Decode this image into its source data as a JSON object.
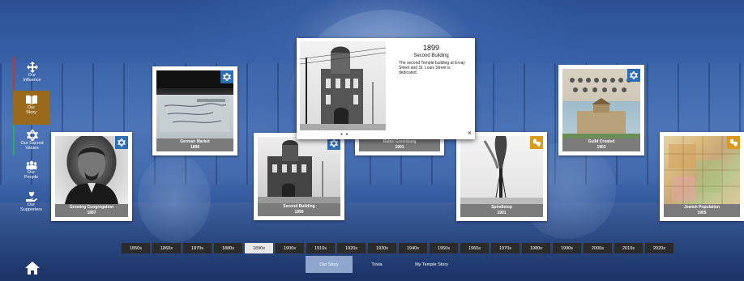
{
  "sidebar": {
    "items": [
      {
        "label1": "Our",
        "label2": "Influence",
        "icon": "arrows-move-icon"
      },
      {
        "label1": "Our",
        "label2": "Story",
        "icon": "open-book-icon"
      },
      {
        "label1": "Our Sacred",
        "label2": "Values",
        "icon": "star-of-david-icon"
      },
      {
        "label1": "Our",
        "label2": "People",
        "icon": "people-group-icon"
      },
      {
        "label1": "Our",
        "label2": "Supporters",
        "icon": "heart-hand-icon"
      }
    ],
    "active_index": 1
  },
  "cards": [
    {
      "title": "Growing Congregation",
      "year": "1897",
      "badge": "blue"
    },
    {
      "title": "German Market",
      "year": "1898",
      "badge": "blue"
    },
    {
      "title": "Second Building",
      "year": "1899",
      "badge": "blue"
    },
    {
      "title": "Rabbi Greenburg",
      "year": "1901",
      "badge": "blue"
    },
    {
      "title": "Spindletop",
      "year": "1901",
      "badge": "gold"
    },
    {
      "title": "Guild Created",
      "year": "1903",
      "badge": "blue"
    },
    {
      "title": "Jewish Population",
      "year": "1905",
      "badge": "gold"
    }
  ],
  "popup": {
    "year": "1899",
    "title": "Second Building",
    "description": "The second Temple building at Ervay Street and St. Louis Street is dedicated.",
    "close": "×",
    "dots": "● ●"
  },
  "decades": [
    "1850s",
    "1860s",
    "1870s",
    "1880s",
    "1890s",
    "1900s",
    "1910s",
    "1920s",
    "1930s",
    "1940s",
    "1950s",
    "1960s",
    "1970s",
    "1980s",
    "1990s",
    "2000s",
    "2010s",
    "2020s"
  ],
  "active_decade": "1890s",
  "tabs": [
    "Our Story",
    "Trivia",
    "My Temple Story"
  ],
  "active_tab": "Our Story",
  "colors": {
    "nav_active": "#9a6a1c",
    "badge_blue": "#2e6db4",
    "badge_gold": "#d99a1d",
    "decade_bg": "#2b2b2b"
  }
}
